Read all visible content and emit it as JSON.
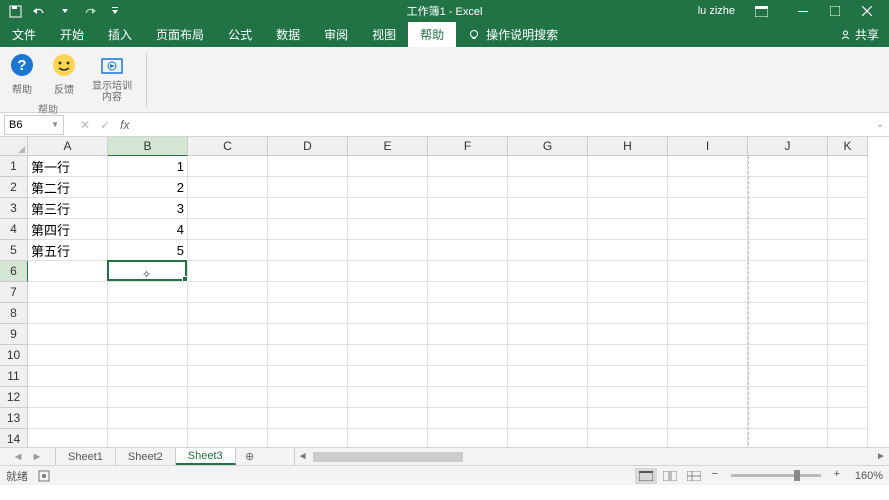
{
  "titlebar": {
    "title": "工作簿1 - Excel",
    "user": "lu zizhe"
  },
  "ribbon": {
    "tabs": [
      "文件",
      "开始",
      "插入",
      "页面布局",
      "公式",
      "数据",
      "审阅",
      "视图",
      "帮助"
    ],
    "active_tab": "帮助",
    "tell_me": "操作说明搜索",
    "share": "共享",
    "help_group": {
      "b1": "帮助",
      "b2": "反馈",
      "b3": "显示培训内容",
      "title": "帮助"
    }
  },
  "formula": {
    "name_box": "B6",
    "value": ""
  },
  "grid": {
    "cols": [
      "A",
      "B",
      "C",
      "D",
      "E",
      "F",
      "G",
      "H",
      "I",
      "J",
      "K"
    ],
    "rows": [
      1,
      2,
      3,
      4,
      5,
      6,
      7,
      8,
      9,
      10,
      11,
      12,
      13,
      14
    ],
    "data": {
      "A": [
        "第一行",
        "第二行",
        "第三行",
        "第四行",
        "第五行"
      ],
      "B": [
        "1",
        "2",
        "3",
        "4",
        "5"
      ]
    },
    "selected": "B6"
  },
  "sheets": {
    "tabs": [
      "Sheet1",
      "Sheet2",
      "Sheet3"
    ],
    "active": "Sheet3"
  },
  "status": {
    "ready": "就绪",
    "zoom": "160%"
  }
}
